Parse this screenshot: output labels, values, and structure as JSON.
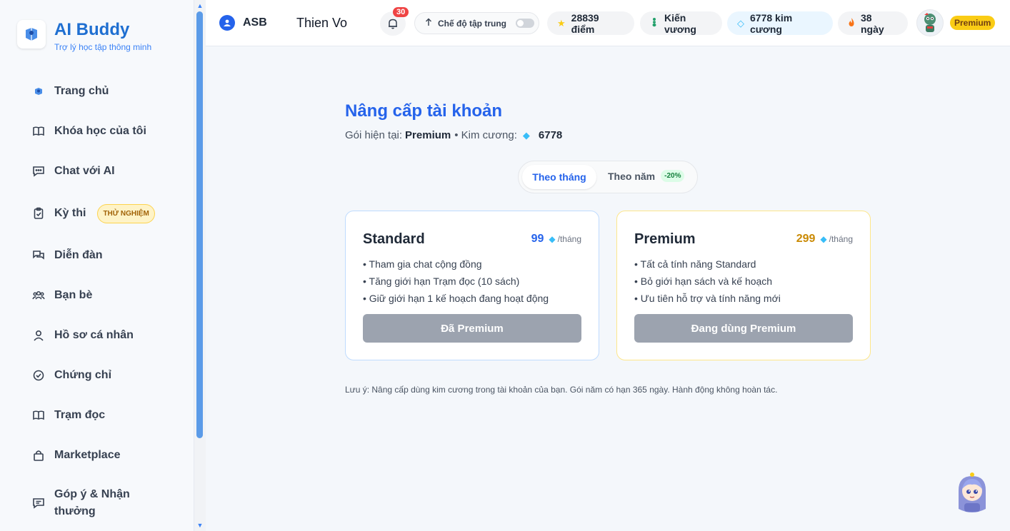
{
  "brand": {
    "title": "AI Buddy",
    "subtitle": "Trợ lý học tập thông minh"
  },
  "sidebar": {
    "items": [
      {
        "label": "Trang chủ",
        "icon": "home-logo-icon"
      },
      {
        "label": "Khóa học của tôi",
        "icon": "book-icon"
      },
      {
        "label": "Chat với AI",
        "icon": "chat-icon"
      },
      {
        "label": "Kỳ thi",
        "icon": "clipboard-icon",
        "badge": "THỬ NGHIỆM"
      },
      {
        "label": "Diễn đàn",
        "icon": "forum-icon"
      },
      {
        "label": "Bạn bè",
        "icon": "users-icon"
      },
      {
        "label": "Hồ sơ cá nhân",
        "icon": "user-icon"
      },
      {
        "label": "Chứng chỉ",
        "icon": "check-circle-icon"
      },
      {
        "label": "Trạm đọc",
        "icon": "book-icon"
      },
      {
        "label": "Marketplace",
        "icon": "bag-icon"
      },
      {
        "label": "Góp ý & Nhận thưởng",
        "icon": "feedback-icon"
      }
    ]
  },
  "header": {
    "short": "ASB",
    "user": "Thien Vo",
    "notifications": "30",
    "focus_mode": "Chế độ tập trung",
    "points": "28839 điểm",
    "rank": "Kiến vương",
    "diamonds": "6778 kim cương",
    "streak": "38 ngày",
    "tier": "Premium"
  },
  "main": {
    "title": "Nâng cấp tài khoản",
    "current_plan_label": "Gói hiện tại:",
    "current_plan": "Premium",
    "diamond_label": "• Kim cương:",
    "diamond_balance": "6778",
    "billing": {
      "monthly": "Theo tháng",
      "yearly": "Theo năm",
      "yearly_discount": "-20%"
    },
    "plans": [
      {
        "name": "Standard",
        "price": "99",
        "unit": "/tháng",
        "features": [
          "• Tham gia chat cộng đồng",
          "• Tăng giới hạn Trạm đọc (10 sách)",
          "• Giữ giới hạn 1 kế hoạch đang hoạt động"
        ],
        "button": "Đã Premium"
      },
      {
        "name": "Premium",
        "price": "299",
        "unit": "/tháng",
        "features": [
          "• Tất cả tính năng Standard",
          "• Bỏ giới hạn sách và kế hoạch",
          "• Ưu tiên hỗ trợ và tính năng mới"
        ],
        "button": "Đang dùng Premium"
      }
    ],
    "note": "Lưu ý: Nâng cấp dùng kim cương trong tài khoản của bạn. Gói năm có hạn 365 ngày. Hành động không hoàn tác."
  },
  "colors": {
    "accent": "#2563eb",
    "premium": "#ca8a04",
    "button_disabled": "#9ca3af"
  }
}
